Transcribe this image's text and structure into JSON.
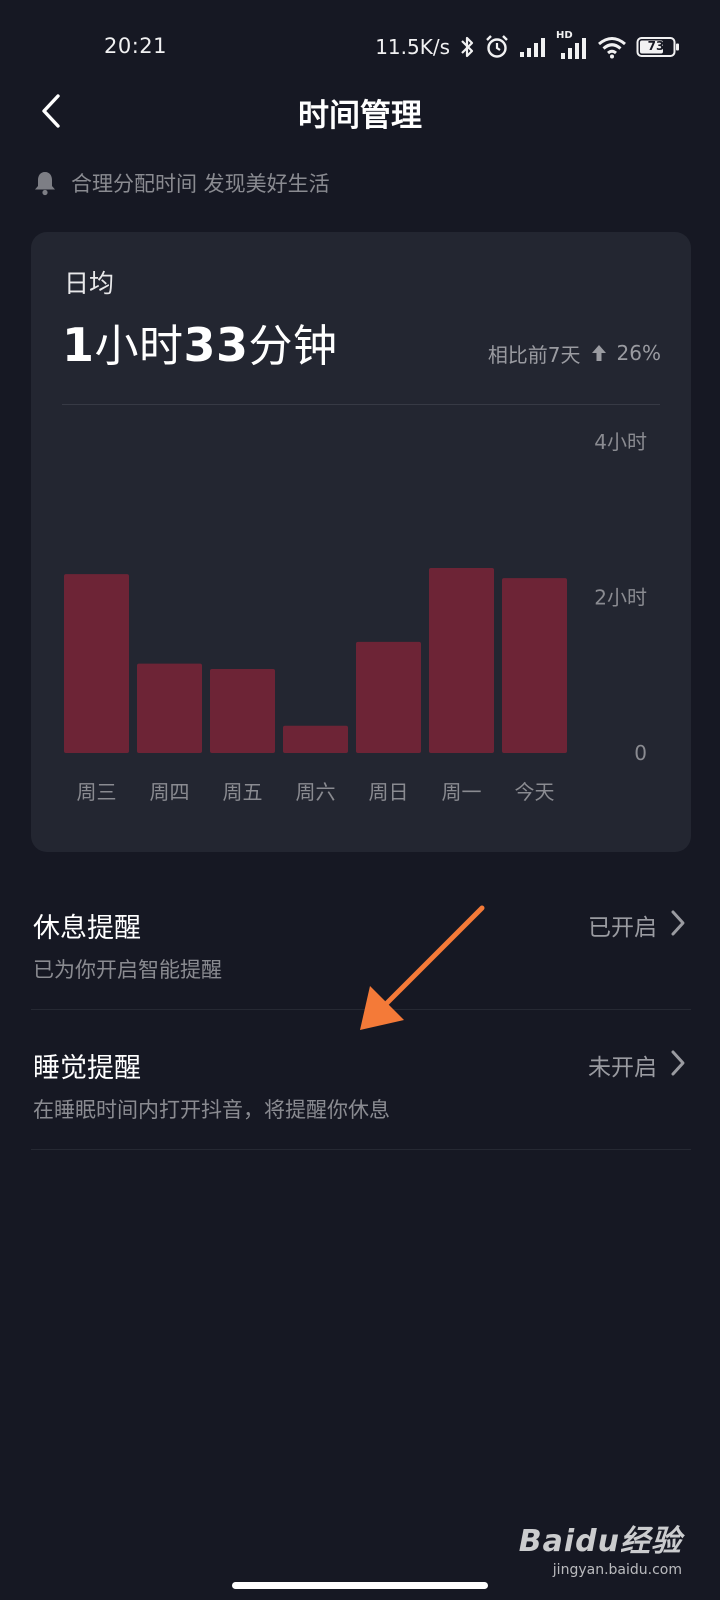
{
  "status_bar": {
    "time": "20:21",
    "speed": "11.5K/s",
    "battery": "73",
    "network_badge": "HD",
    "icons": [
      "bluetooth-icon",
      "alarm-icon",
      "signal-icon",
      "signal-hd-icon",
      "wifi-icon",
      "battery-icon"
    ]
  },
  "nav": {
    "title": "时间管理",
    "back_icon": "chevron-left-icon"
  },
  "tip": {
    "icon": "bell-icon",
    "text": "合理分配时间 发现美好生活"
  },
  "card": {
    "avg_label": "日均",
    "avg_value_parts": {
      "h_num": "1",
      "h_unit": "小时",
      "m_num": "33",
      "m_unit": "分钟"
    },
    "compare_text": "相比前7天",
    "compare_icon": "arrow-up-icon",
    "compare_value": "26%"
  },
  "chart_data": {
    "type": "bar",
    "categories": [
      "周三",
      "周四",
      "周五",
      "周六",
      "周日",
      "周一",
      "今天"
    ],
    "values": [
      2.3,
      1.15,
      1.08,
      0.35,
      1.43,
      2.38,
      2.25
    ],
    "ylim": [
      0,
      4
    ],
    "ytick_labels": [
      "4小时",
      "2小时",
      "0"
    ],
    "ytick_values": [
      4,
      2,
      0
    ],
    "bar_color": "#6d2436",
    "grid": false
  },
  "rows": [
    {
      "title": "休息提醒",
      "subtitle": "已为你开启智能提醒",
      "status": "已开启"
    },
    {
      "title": "睡觉提醒",
      "subtitle": "在睡眠时间内打开抖音，将提醒你休息",
      "status": "未开启"
    }
  ],
  "colors": {
    "background": "#161823",
    "card": "#232631",
    "annotation_arrow": "#f47a38"
  },
  "watermark": {
    "logo": "Baidu经验",
    "url": "jingyan.baidu.com"
  }
}
